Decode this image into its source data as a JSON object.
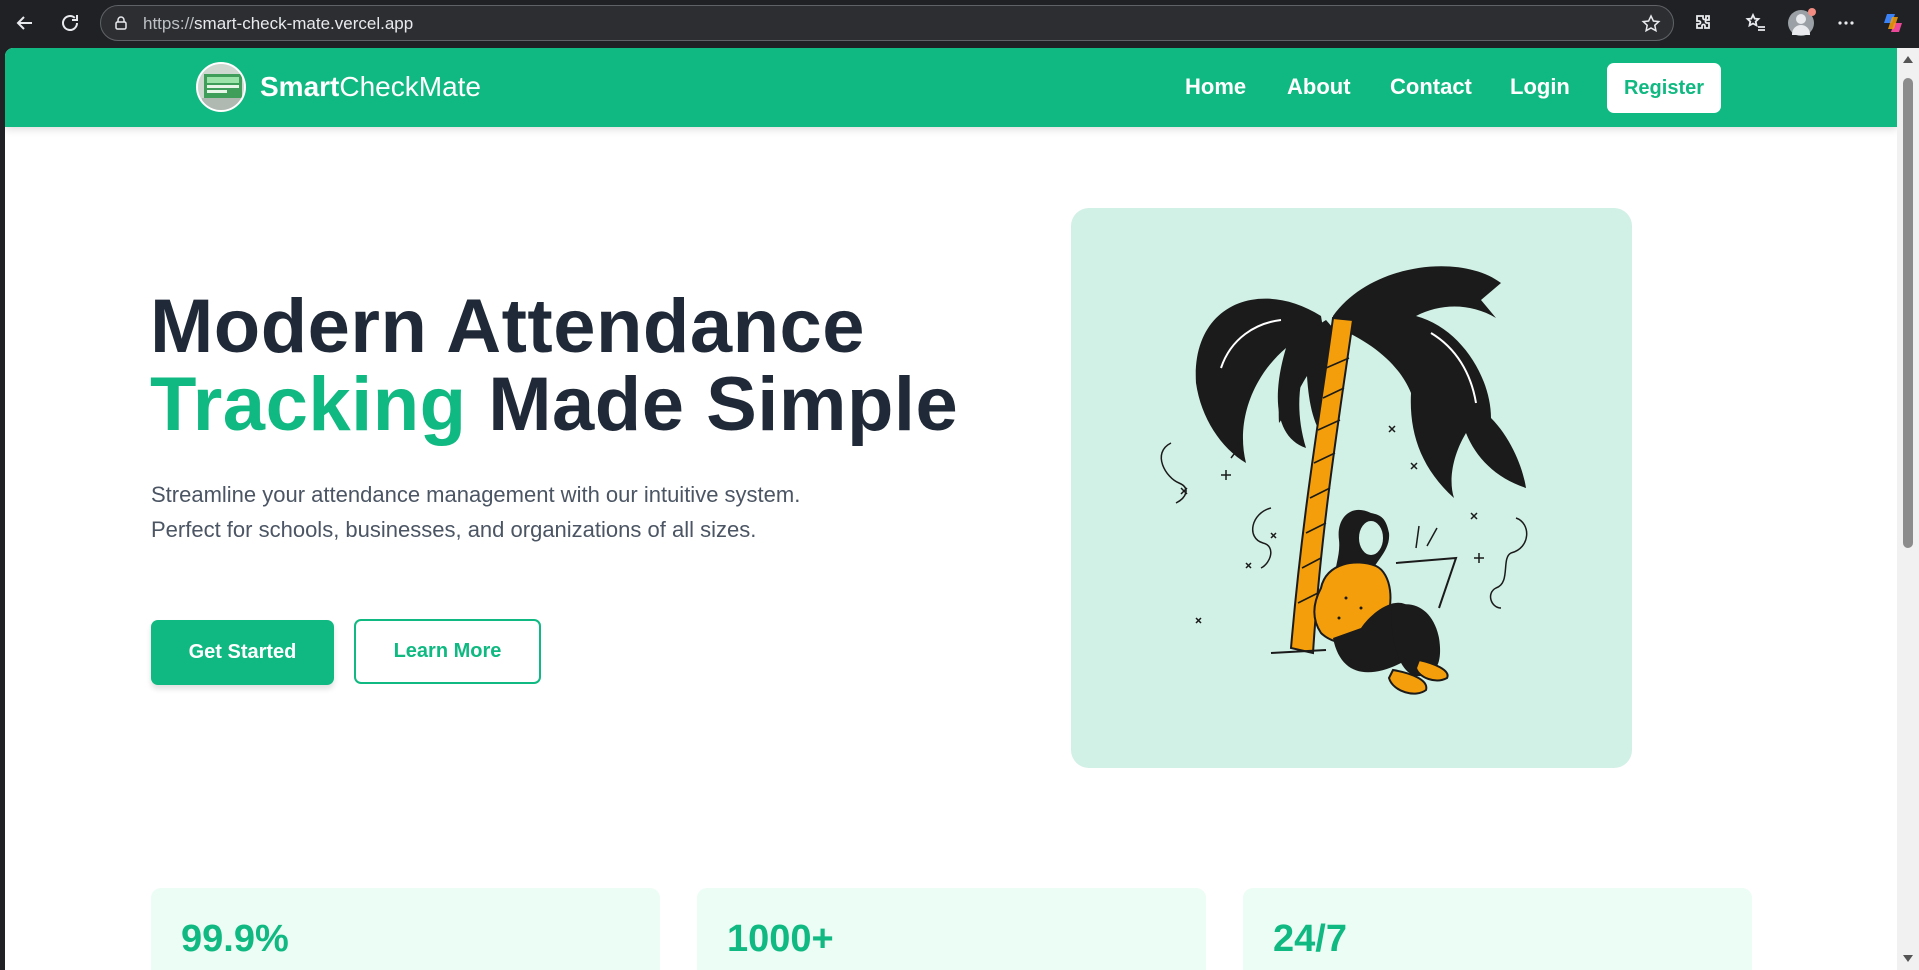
{
  "browser": {
    "url_scheme": "https://",
    "url_host": "smart-check-mate.vercel.app"
  },
  "site": {
    "logo_bold": "Smart",
    "logo_light": "CheckMate",
    "nav": {
      "home": "Home",
      "about": "About",
      "contact": "Contact",
      "login": "Login",
      "register": "Register"
    }
  },
  "hero": {
    "title_line1": "Modern Attendance",
    "title_accent": "Tracking",
    "title_rest": " Made Simple",
    "description": "Streamline your attendance management with our intuitive system. Perfect for schools, businesses, and organizations of all sizes.",
    "primary_button": "Get Started",
    "secondary_button": "Learn More"
  },
  "stats": [
    {
      "value": "99.9%"
    },
    {
      "value": "1000+"
    },
    {
      "value": "24/7"
    }
  ],
  "colors": {
    "brand": "#10b981",
    "illustration_bg": "#d1f0e6",
    "heading": "#1f2937"
  }
}
